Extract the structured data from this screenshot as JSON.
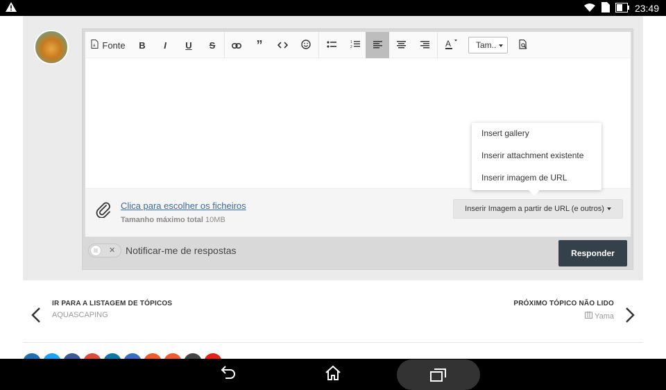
{
  "status_bar": {
    "time": "23:49"
  },
  "editor": {
    "toolbar": {
      "font_label": "Fonte",
      "size_label": "Tam.."
    },
    "attach": {
      "link_text": "Clica para escolher os ficheiros",
      "size_label": "Tamanho máximo total",
      "size_value": "10MB"
    },
    "insert_button": "Inserir Imagem a partir de URL (e outros)",
    "dropdown": {
      "items": [
        "Insert gallery",
        "Inserir attachment existente",
        "Inserir imagem de URL"
      ]
    },
    "notify_label": "Notificar-me de respostas",
    "reply_button": "Responder"
  },
  "navigation": {
    "prev": {
      "heading": "IR PARA A LISTAGEM DE TÓPICOS",
      "sub": "AQUASCAPING"
    },
    "next": {
      "heading": "PRÓXIMO TÓPICO NÃO LIDO",
      "sub": "Yama"
    }
  },
  "colors": {
    "reply_button": "#34414a",
    "link": "#3b6a9a",
    "share": [
      "#1f6fb5",
      "#1da1f2",
      "#3b5998",
      "#dd4b39",
      "#0e76a8",
      "#3a6bc6",
      "#f05a28",
      "#ef5a31",
      "#444444",
      "#e62117"
    ]
  }
}
